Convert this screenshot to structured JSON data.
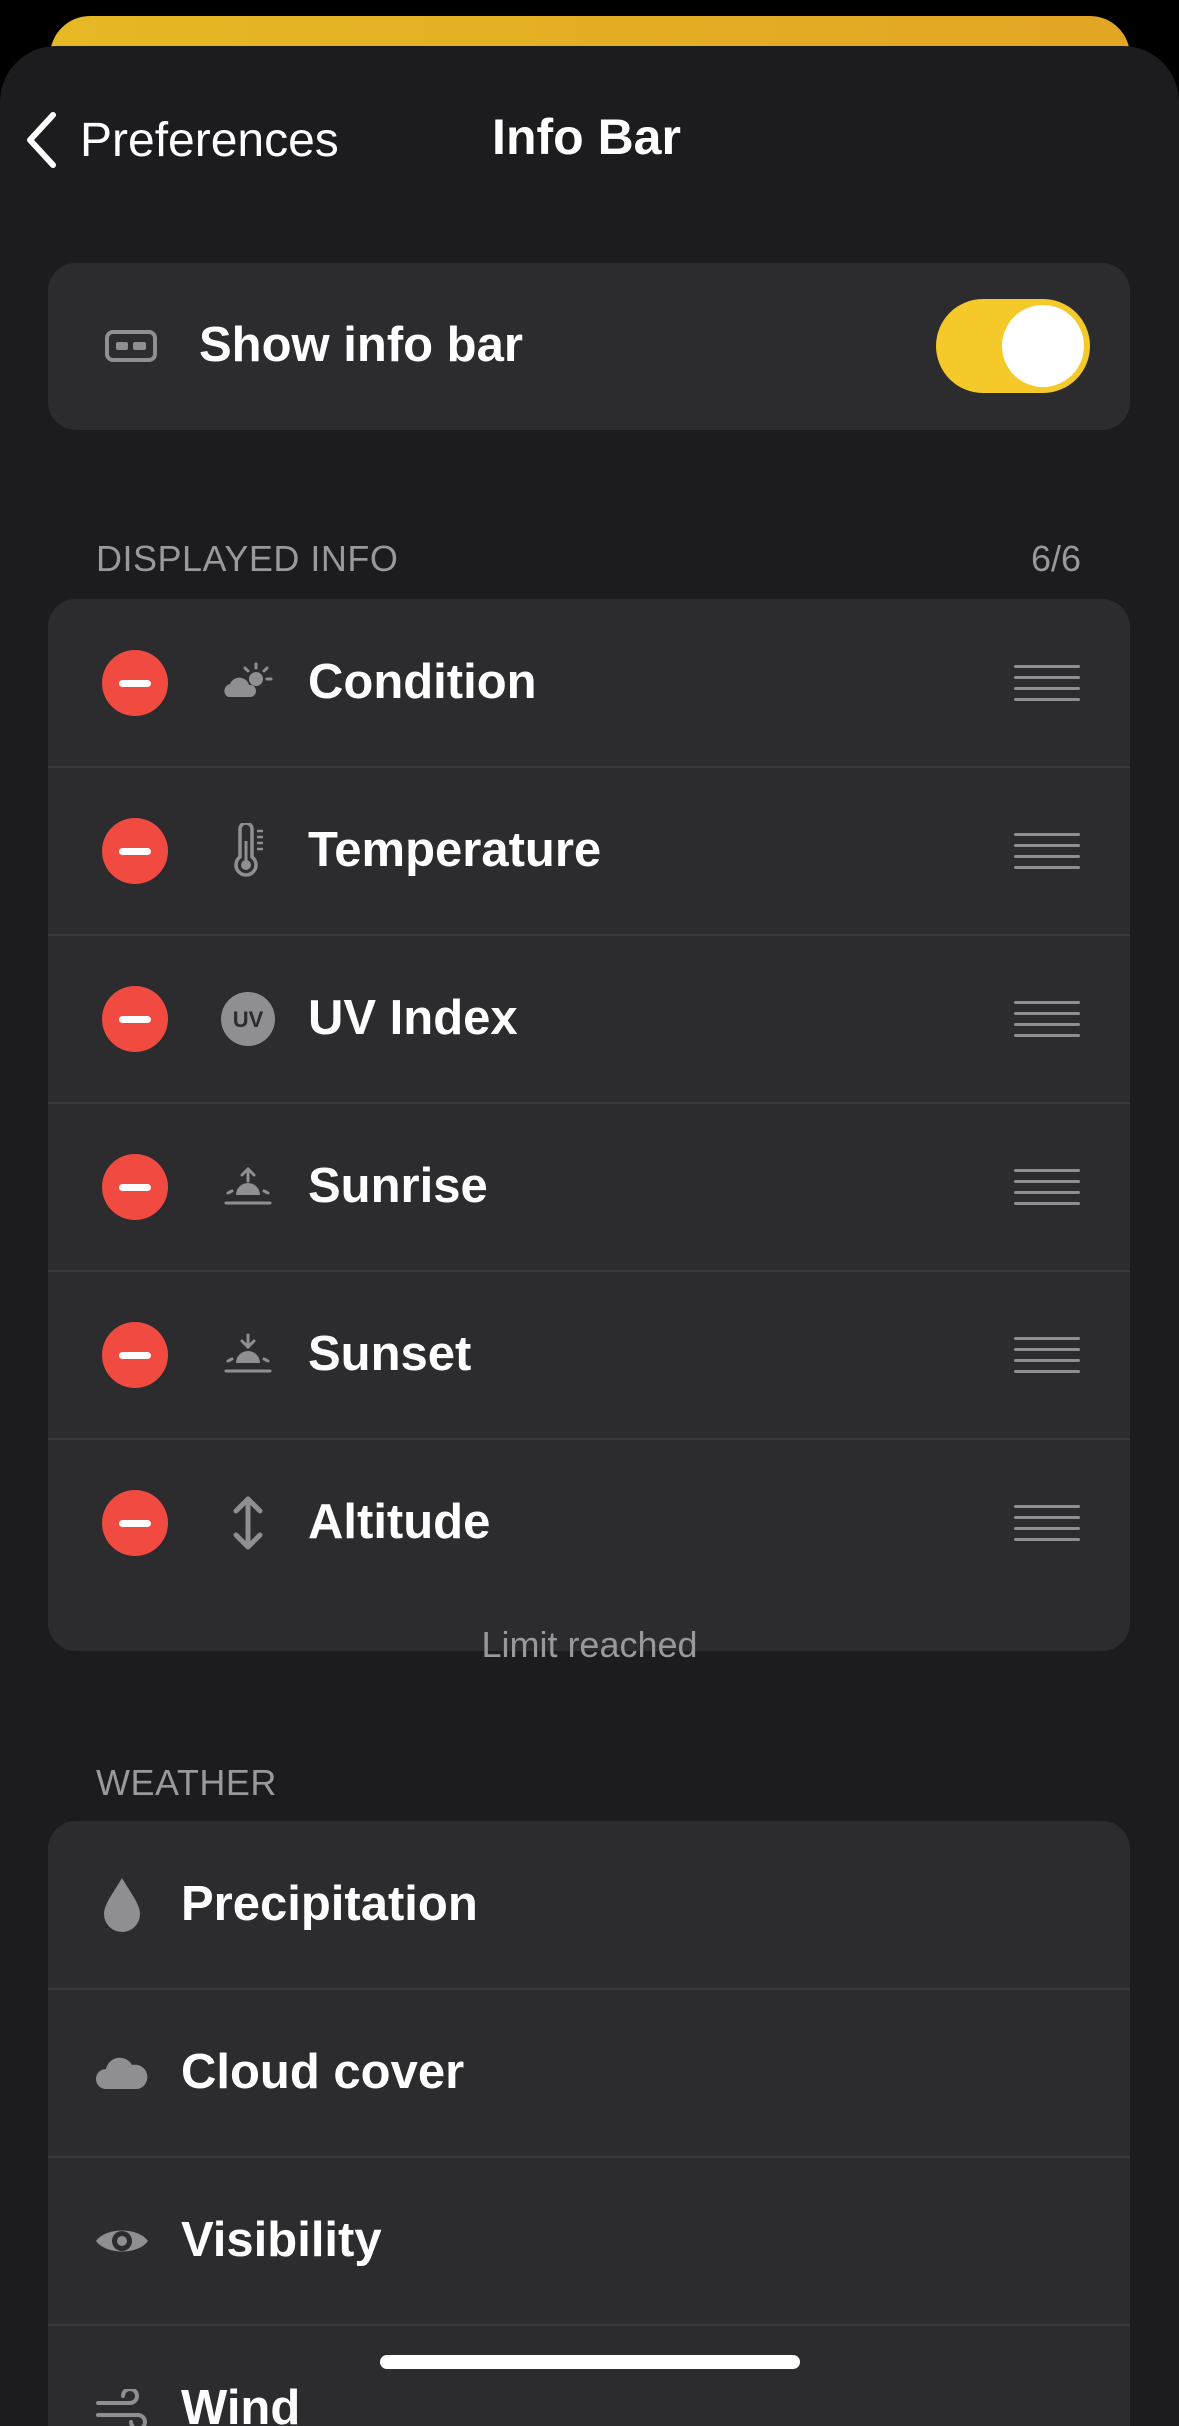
{
  "nav": {
    "back_label": "Preferences",
    "title": "Info Bar"
  },
  "toggle_row": {
    "label": "Show info bar",
    "enabled": true,
    "icon": "info-bar-icon"
  },
  "displayed": {
    "header": "DISPLAYED INFO",
    "count": "6/6",
    "items": [
      {
        "label": "Condition",
        "icon": "sun-behind-cloud-icon"
      },
      {
        "label": "Temperature",
        "icon": "thermometer-icon"
      },
      {
        "label": "UV Index",
        "icon": "uv-icon",
        "icon_text": "UV"
      },
      {
        "label": "Sunrise",
        "icon": "sunrise-icon"
      },
      {
        "label": "Sunset",
        "icon": "sunset-icon"
      },
      {
        "label": "Altitude",
        "icon": "up-down-arrow-icon"
      }
    ],
    "footer": "Limit reached"
  },
  "weather": {
    "header": "WEATHER",
    "items": [
      {
        "label": "Precipitation",
        "icon": "drop-icon"
      },
      {
        "label": "Cloud cover",
        "icon": "cloud-icon"
      },
      {
        "label": "Visibility",
        "icon": "eye-icon"
      },
      {
        "label": "Wind",
        "icon": "wind-icon"
      }
    ]
  },
  "colors": {
    "background": "#1c1c1e",
    "card": "#2c2c2e",
    "accent": "#f4c929",
    "remove": "#f14a41",
    "secondary_text": "#98989d"
  }
}
